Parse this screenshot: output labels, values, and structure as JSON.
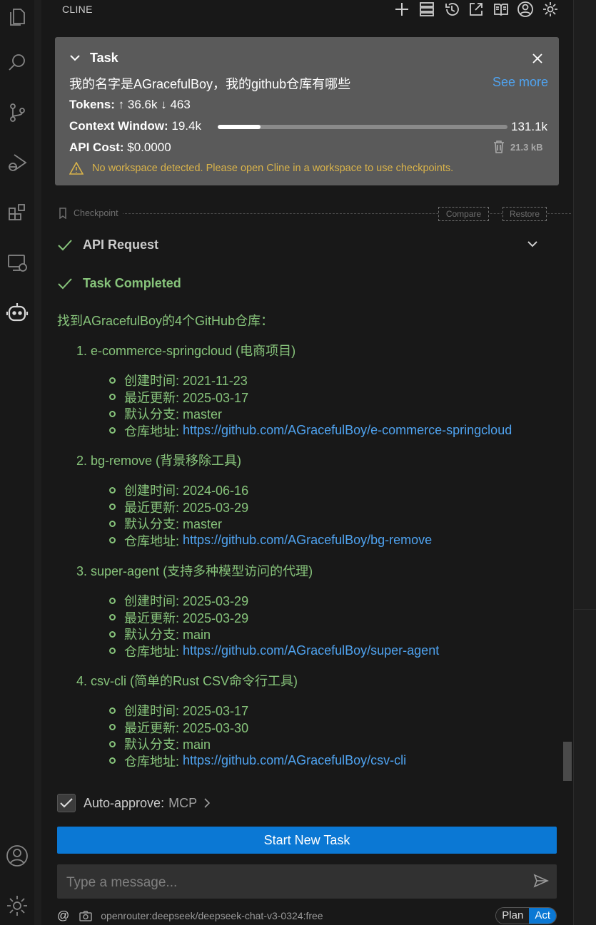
{
  "activity_bar": {
    "top": [
      "files-icon",
      "search-icon",
      "source-control-icon",
      "run-debug-icon",
      "extensions-icon",
      "remote-explorer-icon",
      "cline-robot-icon"
    ],
    "bottom": [
      "account-icon",
      "manage-gear-icon"
    ]
  },
  "header": {
    "title": "CLINE",
    "actions": [
      "plus-icon",
      "mcp-servers-icon",
      "history-icon",
      "popout-icon",
      "book-icon",
      "account-circle-icon",
      "gear-icon"
    ]
  },
  "task": {
    "label": "Task",
    "text": "我的名字是AGracefulBoy，我的github仓库有哪些",
    "see_more": "See more",
    "tokens_label": "Tokens:",
    "tokens_in": "36.6k",
    "tokens_out": "463",
    "context_label": "Context Window:",
    "context_used": "19.4k",
    "context_max": "131.1k",
    "context_fraction": 0.148,
    "api_cost_label": "API Cost:",
    "api_cost": "$0.0000",
    "size": "21.3 kB",
    "warning": "No workspace detected. Please open Cline in a workspace to use checkpoints."
  },
  "checkpoint": {
    "label": "Checkpoint",
    "compare": "Compare",
    "restore": "Restore"
  },
  "api_request": {
    "label": "API Request"
  },
  "task_completed": {
    "label": "Task Completed"
  },
  "result": {
    "intro": "找到AGracefulBoy的4个GitHub仓库：",
    "repos": [
      {
        "heading": "1. e-commerce-springcloud (电商项目)",
        "created": "创建时间: 2021-11-23",
        "updated": "最近更新: 2025-03-17",
        "branch": "默认分支: master",
        "url_label": "仓库地址: ",
        "url": "https://github.com/AGracefulBoy/e-commerce-springcloud"
      },
      {
        "heading": "2. bg-remove (背景移除工具)",
        "created": "创建时间: 2024-06-16",
        "updated": "最近更新: 2025-03-29",
        "branch": "默认分支: master",
        "url_label": "仓库地址: ",
        "url": "https://github.com/AGracefulBoy/bg-remove"
      },
      {
        "heading": "3. super-agent (支持多种模型访问的代理)",
        "created": "创建时间: 2025-03-29",
        "updated": "最近更新: 2025-03-29",
        "branch": "默认分支: main",
        "url_label": "仓库地址: ",
        "url": "https://github.com/AGracefulBoy/super-agent"
      },
      {
        "heading": "4. csv-cli (简单的Rust CSV命令行工具)",
        "created": "创建时间: 2025-03-17",
        "updated": "最近更新: 2025-03-30",
        "branch": "默认分支: main",
        "url_label": "仓库地址: ",
        "url": "https://github.com/AGracefulBoy/csv-cli"
      }
    ]
  },
  "auto_approve": {
    "label": "Auto-approve:",
    "value": "MCP"
  },
  "start_new_task": "Start New Task",
  "input": {
    "placeholder": "Type a message..."
  },
  "footer": {
    "at": "@",
    "model": "openrouter:deepseek/deepseek-chat-v3-0324:free",
    "plan": "Plan",
    "act": "Act"
  },
  "colors": {
    "accent": "#0b78d4",
    "success": "#87c47b",
    "link": "#4fa3f0",
    "warning": "#d9b34a"
  }
}
